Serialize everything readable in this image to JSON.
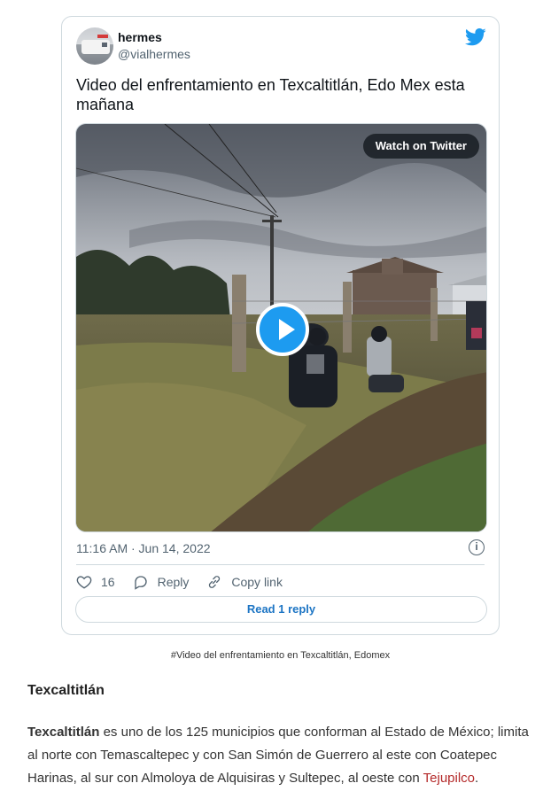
{
  "tweet": {
    "author_name": "hermes",
    "author_handle": "@vialhermes",
    "text": "Video del enfrentamiento en Texcaltitlán, Edo Mex esta mañana",
    "watch_label": "Watch on Twitter",
    "timestamp": "11:16 AM · Jun 14, 2022",
    "likes_count": "16",
    "reply_label": "Reply",
    "copy_link_label": "Copy link",
    "read_replies_label": "Read 1 reply",
    "info_glyph": "i",
    "icons": [
      "twitter-bird-icon",
      "play-icon",
      "info-icon",
      "heart-icon",
      "reply-icon",
      "link-icon"
    ],
    "accent_color": "#1d9bf0"
  },
  "article": {
    "caption": "#Video del enfrentamiento en Texcaltitlán, Edomex",
    "section_title": "Texcaltitlán",
    "para_bold": "Texcaltitlán",
    "para_main": " es uno de los 125 municipios que conforman al Estado de México; limita al norte con Temascaltepec y con San Simón de Guerrero al este con Coatepec Harinas, al sur con Almoloya de Alquisiras y Sultepec, al oeste con ",
    "para_link": "Tejupilco",
    "para_end": "."
  }
}
